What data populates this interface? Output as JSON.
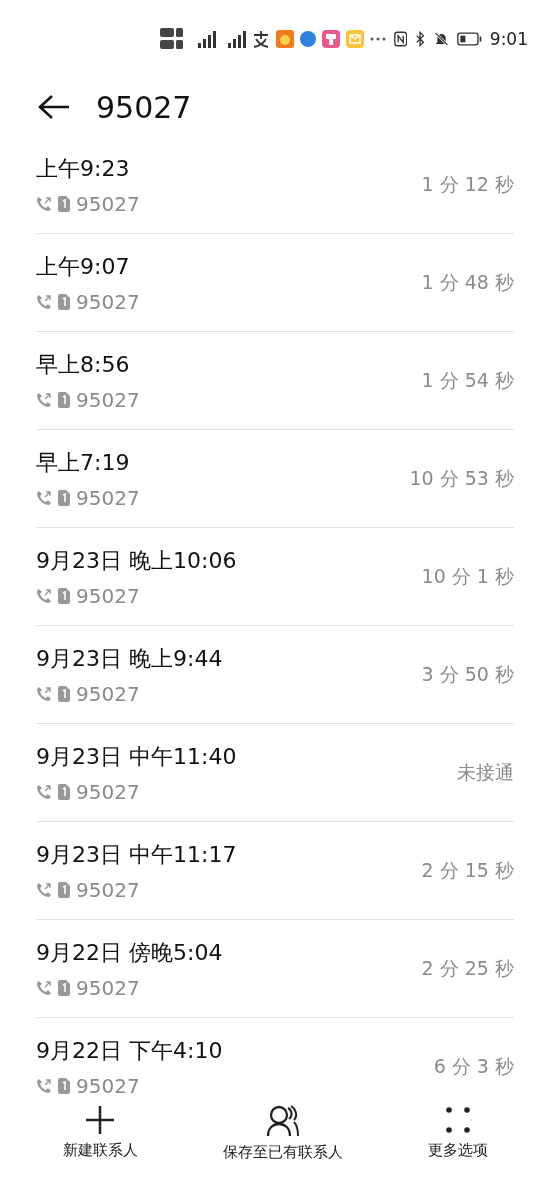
{
  "status_bar": {
    "time": "9:01"
  },
  "header": {
    "title": "95027"
  },
  "calls": [
    {
      "time": "上午9:23",
      "number": "95027",
      "duration": "1 分 12 秒"
    },
    {
      "time": "上午9:07",
      "number": "95027",
      "duration": "1 分 48 秒"
    },
    {
      "time": "早上8:56",
      "number": "95027",
      "duration": "1 分 54 秒"
    },
    {
      "time": "早上7:19",
      "number": "95027",
      "duration": "10 分 53 秒"
    },
    {
      "time": "9月23日 晚上10:06",
      "number": "95027",
      "duration": "10 分 1 秒"
    },
    {
      "time": "9月23日 晚上9:44",
      "number": "95027",
      "duration": "3 分 50 秒"
    },
    {
      "time": "9月23日 中午11:40",
      "number": "95027",
      "duration": "未接通"
    },
    {
      "time": "9月23日 中午11:17",
      "number": "95027",
      "duration": "2 分 15 秒"
    },
    {
      "time": "9月22日 傍晚5:04",
      "number": "95027",
      "duration": "2 分 25 秒"
    },
    {
      "time": "9月22日 下午4:10",
      "number": "95027",
      "duration": "6 分 3 秒"
    }
  ],
  "actions": [
    {
      "kind": "add",
      "label": "新建联系人"
    },
    {
      "kind": "contact",
      "label": "保存至已有联系人"
    },
    {
      "kind": "more",
      "label": "更多选项"
    }
  ]
}
